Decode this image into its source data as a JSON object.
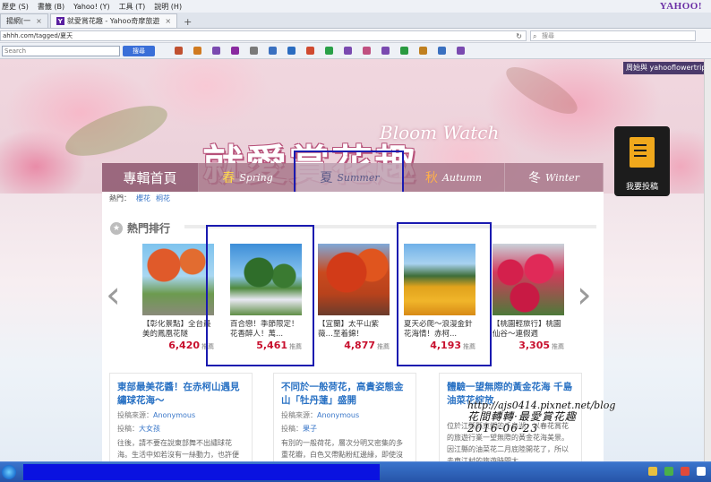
{
  "browser": {
    "menu": [
      "歷史 (S)",
      "書籤 (B)",
      "Yahoo! (Y)",
      "工具 (T)",
      "說明 (H)"
    ],
    "brand": "YAHOO!",
    "tabs": [
      {
        "label": "揚網(一",
        "active": false
      },
      {
        "label": "就愛賞花趣 - Yahoo奇摩旅遊",
        "active": true
      }
    ],
    "url": "ahhh.com/tagged/夏天",
    "search_placeholder": "搜尋",
    "toolbar_search_placeholder": "Search",
    "toolbar_button": "搜尋",
    "toolbar_icons": [
      "#c05030",
      "#d07a20",
      "#7a4ab0",
      "#8a2aa0",
      "#7a7a7a",
      "#3a70c0",
      "#2a6cc0",
      "#d04a30",
      "#2aa048",
      "#7a4ab0",
      "#c05080",
      "#7a4ab0",
      "#2a9a40",
      "#c08020",
      "#3a70c0",
      "#7a4ab0"
    ]
  },
  "page": {
    "bloom_watch": "Bloom Watch",
    "banner_title": "就愛賞花趣",
    "side_pill": "周始與 yahooflowertrip",
    "contribute_label": "我要投稿",
    "nav": {
      "home": "專輯首頁",
      "spring_zh": "春",
      "spring_en": "Spring",
      "summer_zh": "夏",
      "summer_en": "Summer",
      "autumn_zh": "秋",
      "autumn_en": "Autumn",
      "winter_zh": "冬",
      "winter_en": "Winter"
    },
    "hot_label": "熱門：",
    "hot_links": [
      "櫻花",
      "桐花"
    ],
    "section_title": "熱門排行",
    "cards": [
      {
        "title": "【彰化景點】全台最美的鳳凰花隧",
        "count": "6,420",
        "unit": "推薦"
      },
      {
        "title": "百合戀！季節限定！花香醉人！萬...",
        "count": "5,461",
        "unit": "推薦"
      },
      {
        "title": "【宜蘭】太平山紫薇…至着錦！",
        "count": "4,877",
        "unit": "推薦"
      },
      {
        "title": "夏天必爬～浪漫金針花海情！赤柯...",
        "count": "4,193",
        "unit": "推薦"
      },
      {
        "title": "【桃園輕旅行】桃園仙谷～連假週",
        "count": "3,305",
        "unit": "推薦"
      }
    ],
    "articles": [
      {
        "title": "東部最美花醬！在赤柯山遇見繡球花海～",
        "source_label": "投稿來源：",
        "author": "Anonymous",
        "tag_label": "投稿：",
        "tag": "大女孩",
        "summary": "往後，請不要在說東部舞不出繡球花海。生活中如若沒有一絲動力，也許便錯過許多季"
      },
      {
        "title": "不同於一般荷花，高貴姿態金山「牡丹蓮」盛開",
        "source_label": "投稿來源：",
        "author": "Anonymous",
        "tag_label": "投稿：",
        "tag": "果子",
        "summary": "有別的一般荷花，層次分明又密集的多重花瓣，白色又帶點粉紅邊緣，即使沒有大貨運"
      },
      {
        "title": "體驗一望無際的黃金花海 千島油菜花綻放",
        "source_label": "",
        "author": "",
        "tag_label": "",
        "tag": "",
        "summary": "位於江縣縣東鄉的千島湖，以春花賞花的旅遊行業一望無際的黃金花海美景。因江縣的油菜花二月底陸開花了，所以去東江村的旅遊時間大"
      }
    ],
    "watermark_line1": "http://ajs0414.pixnet.net/blog",
    "watermark_line2": "花間轉轉·最愛賞花趣",
    "watermark_line3": "2016-06-23"
  },
  "taskbar": {
    "tray_icons": [
      "#e8c040",
      "#4ab04a",
      "#e04a3a",
      "#ffffff"
    ]
  }
}
